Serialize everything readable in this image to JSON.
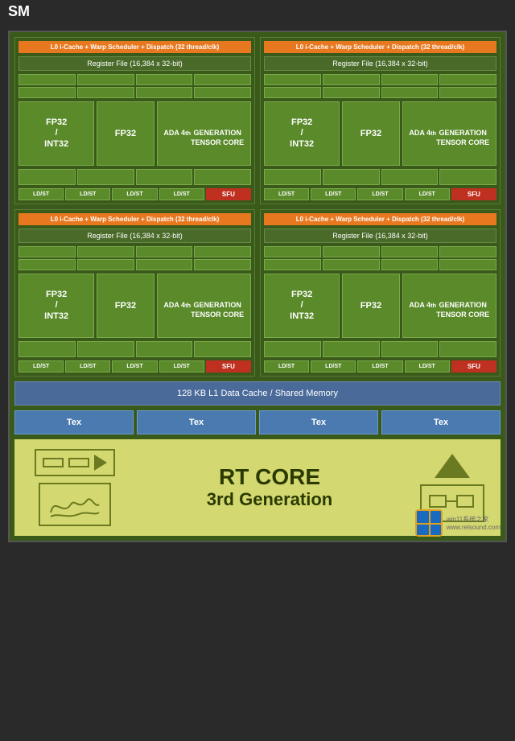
{
  "sm_label": "SM",
  "quadrants": [
    {
      "l0_text": "L0 i-Cache + Warp Scheduler + Dispatch (32 thread/clk)",
      "reg_file_text": "Register File (16,384 x 32-bit)",
      "fp32_label": "FP32\n/\nINT32",
      "fp32_single": "FP32",
      "tensor_label": "ADA 4th\nGENERATION\nTENSOR CORE",
      "ldst_labels": [
        "LD/ST",
        "LD/ST",
        "LD/ST",
        "LD/ST"
      ],
      "sfu_label": "SFU"
    },
    {
      "l0_text": "L0 i-Cache + Warp Scheduler + Dispatch (32 thread/clk)",
      "reg_file_text": "Register File (16,384 x 32-bit)",
      "fp32_label": "FP32\n/\nINT32",
      "fp32_single": "FP32",
      "tensor_label": "ADA 4th\nGENERATION\nTENSOR CORE",
      "ldst_labels": [
        "LD/ST",
        "LD/ST",
        "LD/ST",
        "LD/ST"
      ],
      "sfu_label": "SFU"
    },
    {
      "l0_text": "L0 i-Cache + Warp Scheduler + Dispatch (32 thread/clk)",
      "reg_file_text": "Register File (16,384 x 32-bit)",
      "fp32_label": "FP32\n/\nINT32",
      "fp32_single": "FP32",
      "tensor_label": "ADA 4th\nGENERATION\nTENSOR CORE",
      "ldst_labels": [
        "LD/ST",
        "LD/ST",
        "LD/ST",
        "LD/ST"
      ],
      "sfu_label": "SFU"
    },
    {
      "l0_text": "L0 i-Cache + Warp Scheduler + Dispatch (32 thread/clk)",
      "reg_file_text": "Register File (16,384 x 32-bit)",
      "fp32_label": "FP32\n/\nINT32",
      "fp32_single": "FP32",
      "tensor_label": "ADA 4th\nGENERATION\nTENSOR CORE",
      "ldst_labels": [
        "LD/ST",
        "LD/ST",
        "LD/ST",
        "LD/ST"
      ],
      "sfu_label": "SFU"
    }
  ],
  "l1_cache_text": "128 KB L1 Data Cache / Shared Memory",
  "tex_labels": [
    "Tex",
    "Tex",
    "Tex",
    "Tex"
  ],
  "rt_core_title": "RT CORE",
  "rt_core_subtitle": "3rd Generation",
  "watermark_site": "win11系统之家",
  "watermark_url": "www.relsound.com"
}
